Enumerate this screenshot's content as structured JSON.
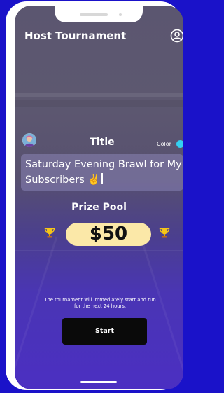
{
  "header": {
    "title": "Host Tournament",
    "profile_icon": "user-circle-icon"
  },
  "title_section": {
    "label": "Title",
    "color_label": "Color",
    "color_value": "#34d0f2",
    "title_value": "Saturday Evening Brawl for My Subscribers ✌️"
  },
  "prize": {
    "label": "Prize Pool",
    "amount": "$50",
    "icon": "trophy-icon"
  },
  "info_text": "The tournament will immediately start and run for the next 24 hours.",
  "start_button": {
    "label": "Start"
  }
}
